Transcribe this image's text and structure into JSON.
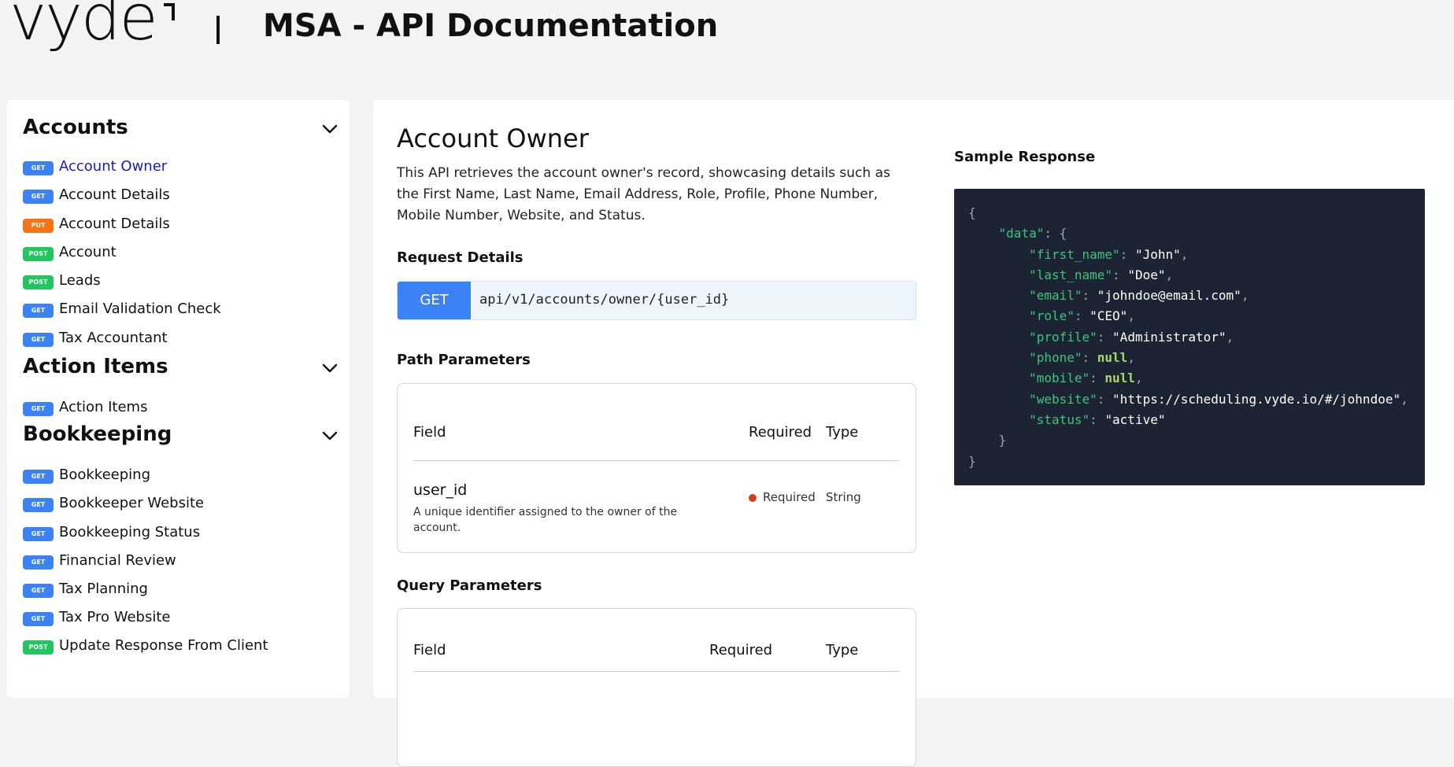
{
  "header": {
    "logo_text": "vyde",
    "title": "MSA - API Documentation"
  },
  "sidebar": {
    "sections": [
      {
        "title": "Accounts",
        "items": [
          {
            "method": "GET",
            "label": "Account Owner",
            "active": true
          },
          {
            "method": "GET",
            "label": "Account Details"
          },
          {
            "method": "PUT",
            "label": "Account Details"
          },
          {
            "method": "POST",
            "label": "Account"
          },
          {
            "method": "POST",
            "label": "Leads"
          },
          {
            "method": "GET",
            "label": "Email Validation Check"
          },
          {
            "method": "GET",
            "label": "Tax Accountant"
          }
        ]
      },
      {
        "title": "Action Items",
        "items": [
          {
            "method": "GET",
            "label": "Action Items"
          }
        ]
      },
      {
        "title": "Bookkeeping",
        "items": [
          {
            "method": "GET",
            "label": "Bookkeeping"
          },
          {
            "method": "GET",
            "label": "Bookkeeper Website"
          },
          {
            "method": "GET",
            "label": "Bookkeeping Status"
          },
          {
            "method": "GET",
            "label": "Financial Review"
          },
          {
            "method": "GET",
            "label": "Tax Planning"
          },
          {
            "method": "GET",
            "label": "Tax Pro Website"
          },
          {
            "method": "POST",
            "label": "Update Response From Client"
          }
        ]
      }
    ]
  },
  "main": {
    "title": "Account Owner",
    "description": "This API retrieves the account owner's record, showcasing details such as the First Name, Last Name, Email Address, Role, Profile, Phone Number, Mobile Number, Website, and Status.",
    "request_details_heading": "Request Details",
    "method": "GET",
    "endpoint": "api/v1/accounts/owner/{user_id}",
    "path_params": {
      "heading": "Path Parameters",
      "columns": {
        "field": "Field",
        "required": "Required",
        "type": "Type"
      },
      "rows": [
        {
          "name": "user_id",
          "description": "A unique identifier assigned to the owner of the account.",
          "required": "Required",
          "type": "String"
        }
      ]
    },
    "query_params": {
      "heading": "Query Parameters",
      "columns": {
        "field": "Field",
        "required": "Required",
        "type": "Type"
      }
    },
    "sample_response": {
      "heading": "Sample Response",
      "root_key": "data",
      "fields": [
        {
          "key": "first_name",
          "value": "\"John\"",
          "kind": "string"
        },
        {
          "key": "last_name",
          "value": "\"Doe\"",
          "kind": "string"
        },
        {
          "key": "email",
          "value": "\"johndoe@email.com\"",
          "kind": "string"
        },
        {
          "key": "role",
          "value": "\"CEO\"",
          "kind": "string"
        },
        {
          "key": "profile",
          "value": "\"Administrator\"",
          "kind": "string"
        },
        {
          "key": "phone",
          "value": "null",
          "kind": "null"
        },
        {
          "key": "mobile",
          "value": "null",
          "kind": "null"
        },
        {
          "key": "website",
          "value": "\"https://scheduling.vyde.io/#/johndoe\"",
          "kind": "string"
        },
        {
          "key": "status",
          "value": "\"active\"",
          "kind": "string"
        }
      ]
    }
  },
  "colors": {
    "get": "#3b82f6",
    "put": "#f97316",
    "post": "#22c55e",
    "active_link": "#1a1ab8",
    "code_bg": "#1c2434",
    "required_dot": "#d63d18"
  },
  "icons": {
    "section_toggle": "chevron-down-icon",
    "required_marker": "dot-icon"
  }
}
